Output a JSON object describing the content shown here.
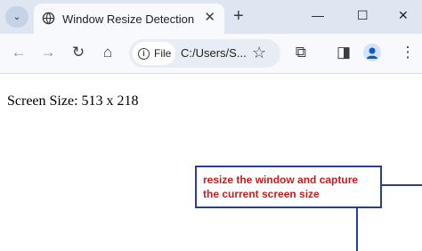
{
  "tab": {
    "title": "Window Resize Detection",
    "close": "✕"
  },
  "titlebar": {
    "tab_menu": "⌄",
    "new_tab": "+",
    "minimize": "—",
    "maximize": "☐",
    "close": "✕"
  },
  "toolbar": {
    "back": "←",
    "forward": "→",
    "reload": "↻",
    "home": "⌂",
    "site_info_label": "File",
    "url": "C:/Users/S...",
    "bookmark": "☆",
    "extensions": "⧉",
    "side_panel": "◨",
    "menu": "⋮"
  },
  "page": {
    "screen_size_text": "Screen Size: 513 x 218"
  },
  "annotation": {
    "text": "resize the window and capture the current screen size"
  },
  "colors": {
    "annotation_border": "#2b3d9b",
    "annotation_text": "#c81c1c",
    "titlebar_bg": "#dfe6f2"
  }
}
